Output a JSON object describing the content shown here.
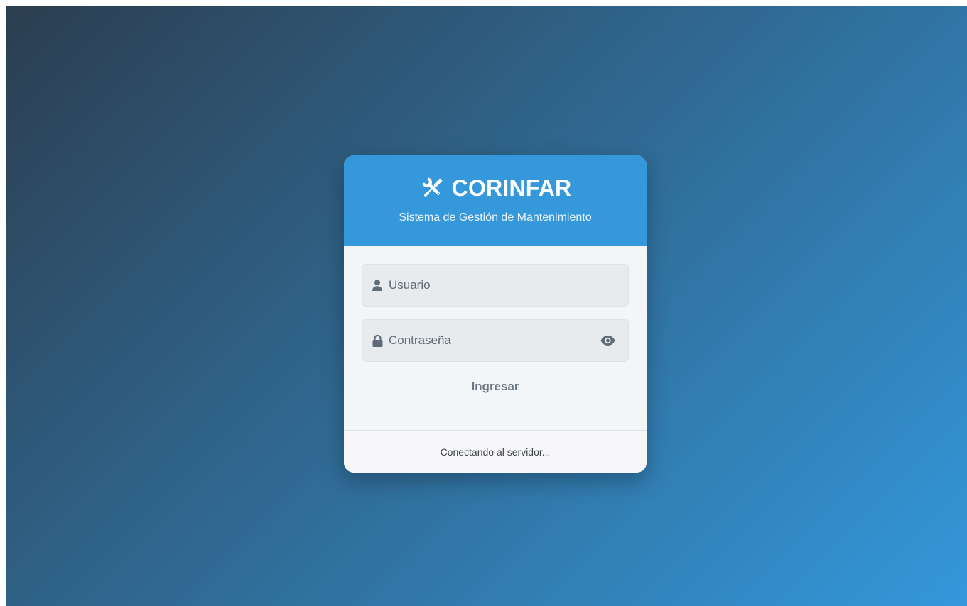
{
  "app": {
    "brand": "CORINFAR",
    "subtitle": "Sistema de Gestión de Mantenimiento",
    "brand_icon": "tools-icon"
  },
  "login": {
    "username": {
      "label": "Usuario",
      "value": "",
      "icon": "user-icon"
    },
    "password": {
      "label": "Contraseña",
      "value": "",
      "icon": "lock-icon",
      "toggle_icon": "eye-icon"
    },
    "submit_label": "Ingresar"
  },
  "status": {
    "text": "Conectando al servidor..."
  },
  "colors": {
    "header": "#3598db",
    "background_start": "#2c3e50",
    "background_end": "#3498db"
  }
}
